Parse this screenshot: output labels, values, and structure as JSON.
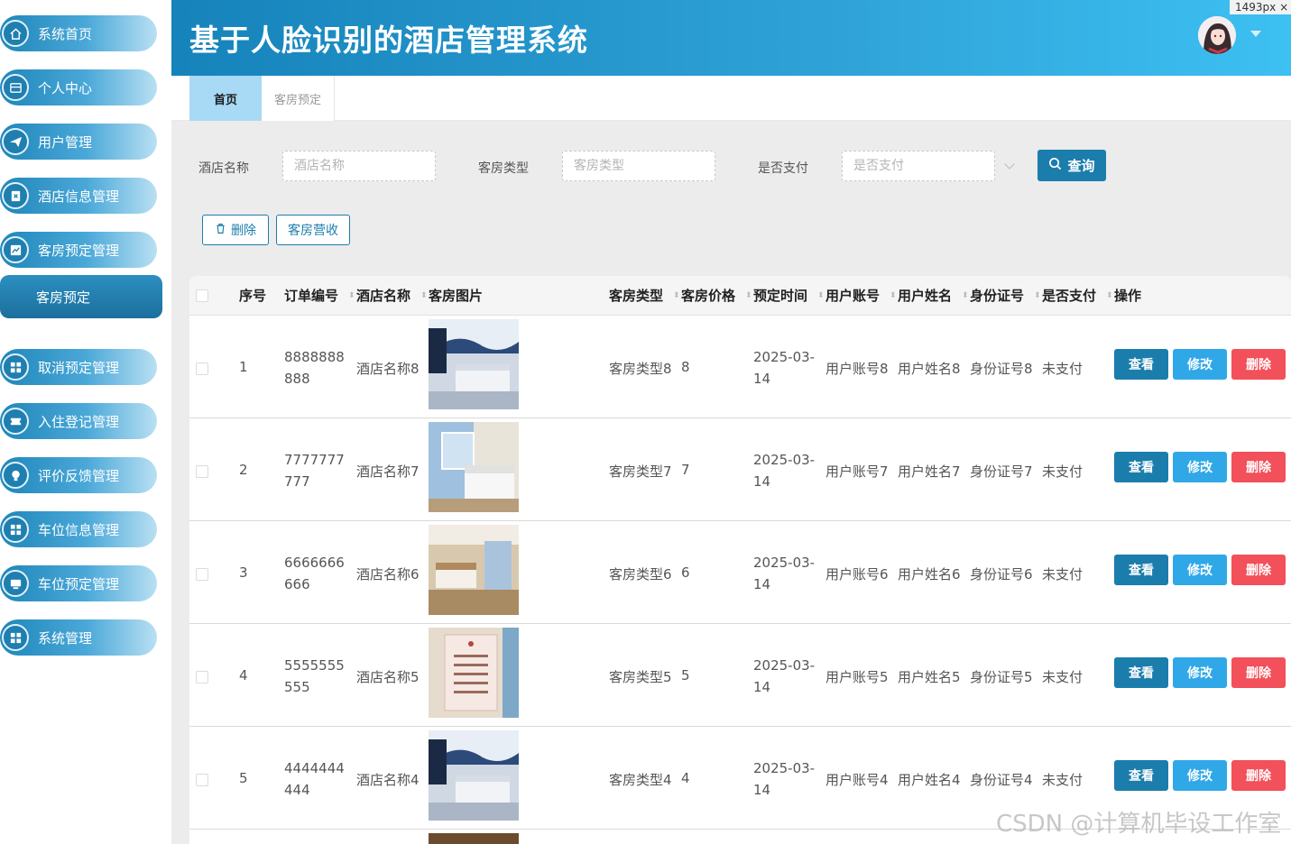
{
  "header": {
    "title": "基于人脸识别的酒店管理系统"
  },
  "badge": "1493px ×",
  "sidebar": {
    "items": [
      {
        "label": "系统首页",
        "icon": "home-icon"
      },
      {
        "label": "个人中心",
        "icon": "card-icon"
      },
      {
        "label": "用户管理",
        "icon": "send-icon"
      },
      {
        "label": "酒店信息管理",
        "icon": "document-x-icon"
      },
      {
        "label": "客房预定管理",
        "icon": "chart-icon"
      },
      {
        "label": "取消预定管理",
        "icon": "grid-icon"
      },
      {
        "label": "入住登记管理",
        "icon": "ticket-icon"
      },
      {
        "label": "评价反馈管理",
        "icon": "bulb-icon"
      },
      {
        "label": "车位信息管理",
        "icon": "grid-icon"
      },
      {
        "label": "车位预定管理",
        "icon": "monitor-icon"
      },
      {
        "label": "系统管理",
        "icon": "grid-icon"
      }
    ],
    "sub_item": "客房预定"
  },
  "tabs": [
    {
      "label": "首页",
      "active": true
    },
    {
      "label": "客房预定",
      "active": false
    }
  ],
  "filters": {
    "hotel_label": "酒店名称",
    "hotel_placeholder": "酒店名称",
    "room_type_label": "客房类型",
    "room_type_placeholder": "客房类型",
    "paid_label": "是否支付",
    "paid_placeholder": "是否支付",
    "query_button": "查询"
  },
  "actions": {
    "delete": "删除",
    "revenue": "客房营收"
  },
  "table": {
    "columns": [
      "序号",
      "订单编号",
      "酒店名称",
      "客房图片",
      "客房类型",
      "客房价格",
      "预定时间",
      "用户账号",
      "用户姓名",
      "身份证号",
      "是否支付",
      "操作"
    ],
    "rows": [
      {
        "index": "1",
        "order": "8888888888",
        "hotel": "酒店名称8",
        "type": "客房类型8",
        "price": "8",
        "time": "2025-03-14",
        "account": "用户账号8",
        "name": "用户姓名8",
        "id": "身份证号8",
        "paid": "未支付"
      },
      {
        "index": "2",
        "order": "7777777777",
        "hotel": "酒店名称7",
        "type": "客房类型7",
        "price": "7",
        "time": "2025-03-14",
        "account": "用户账号7",
        "name": "用户姓名7",
        "id": "身份证号7",
        "paid": "未支付"
      },
      {
        "index": "3",
        "order": "6666666666",
        "hotel": "酒店名称6",
        "type": "客房类型6",
        "price": "6",
        "time": "2025-03-14",
        "account": "用户账号6",
        "name": "用户姓名6",
        "id": "身份证号6",
        "paid": "未支付"
      },
      {
        "index": "4",
        "order": "5555555555",
        "hotel": "酒店名称5",
        "type": "客房类型5",
        "price": "5",
        "time": "2025-03-14",
        "account": "用户账号5",
        "name": "用户姓名5",
        "id": "身份证号5",
        "paid": "未支付"
      },
      {
        "index": "5",
        "order": "4444444444",
        "hotel": "酒店名称4",
        "type": "客房类型4",
        "price": "4",
        "time": "2025-03-14",
        "account": "用户账号4",
        "name": "用户姓名4",
        "id": "身份证号4",
        "paid": "未支付"
      }
    ],
    "row_actions": {
      "view": "查看",
      "edit": "修改",
      "delete": "删除"
    }
  },
  "watermark": "CSDN @计算机毕设工作室"
}
